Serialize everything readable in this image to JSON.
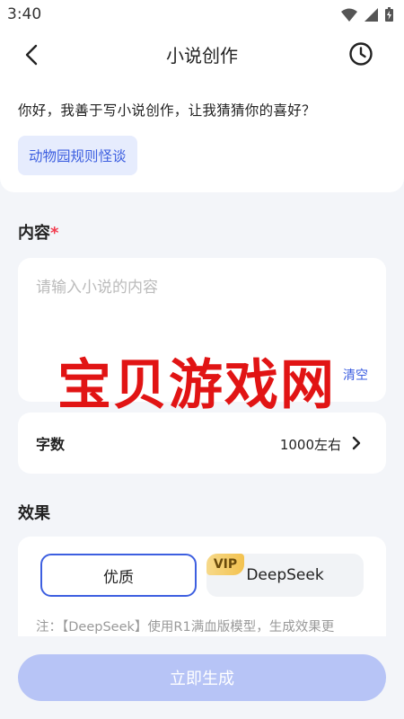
{
  "status_bar": {
    "time": "3:40",
    "icons": [
      "wifi-icon",
      "signal-icon",
      "battery-icon"
    ]
  },
  "header": {
    "title": "小说创作",
    "back_icon": "chevron-left-icon",
    "history_icon": "clock-icon"
  },
  "greeting": "你好，我善于写小说创作，让我猜猜你的喜好？",
  "suggestion": {
    "label": "动物园规则怪谈"
  },
  "content_section": {
    "label": "内容",
    "required_mark": "*",
    "placeholder": "请输入小说的内容",
    "clear_label": "清空"
  },
  "word_count": {
    "label": "字数",
    "value": "1000左右"
  },
  "effect_section": {
    "label": "效果",
    "options": [
      {
        "label": "优质",
        "selected": true
      },
      {
        "label": "DeepSeek",
        "badge": "VIP",
        "selected": false
      }
    ],
    "note": "注：【DeepSeek】使用R1满血版模型，生成效果更"
  },
  "watermark": "宝贝游戏网",
  "generate_button": {
    "label": "立即生成"
  },
  "colors": {
    "accent": "#3d5fe0",
    "chip_bg": "#e6ecfd",
    "button_disabled": "#b7c4f6",
    "required": "#f23b4e",
    "watermark": "#e11414"
  }
}
